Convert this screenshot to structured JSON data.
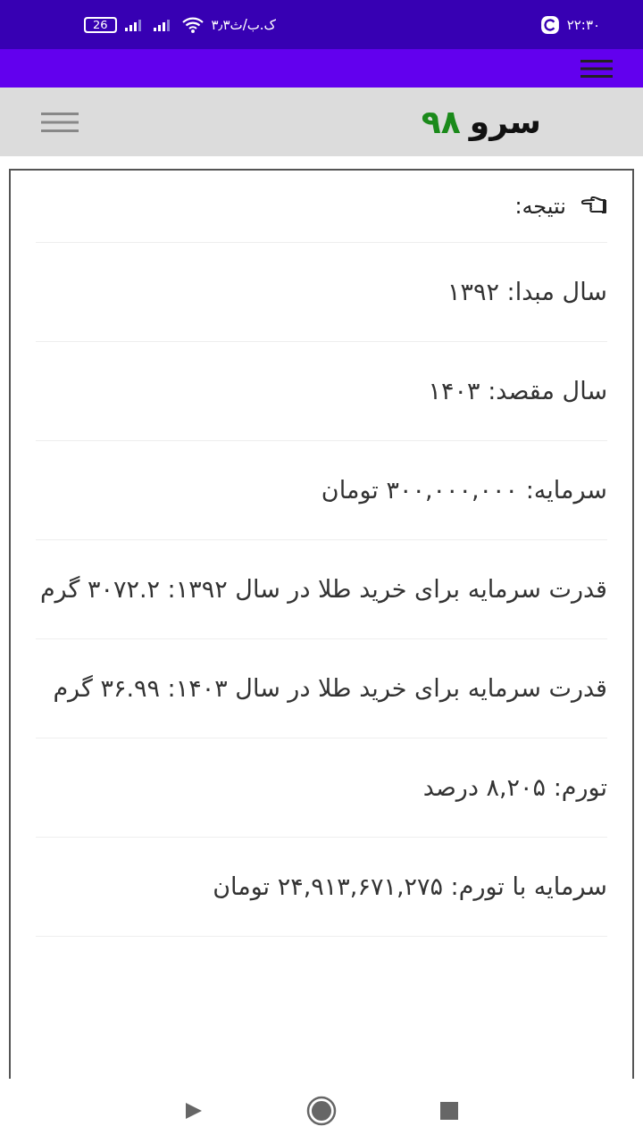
{
  "status_bar": {
    "time": "۲۲:۳۰",
    "speed": "۳٫۳ک.ب/ث",
    "battery": "26"
  },
  "header": {
    "logo_word": "سرو",
    "logo_number": "۹۸"
  },
  "result": {
    "title": "نتیجه:",
    "items": [
      {
        "text": "سال مبدا: ۱۳۹۲"
      },
      {
        "text": "سال مقصد: ۱۴۰۳"
      },
      {
        "text": "سرمایه: ۳۰۰,۰۰۰,۰۰۰ تومان"
      },
      {
        "text": "قدرت سرمایه برای خرید طلا در سال ۱۳۹۲: ۳۰۷۲.۲ گرم"
      },
      {
        "text": "قدرت سرمایه برای خرید طلا در سال ۱۴۰۳: ۳۶.۹۹ گرم"
      },
      {
        "text": "تورم: ۸,۲۰۵ درصد"
      },
      {
        "text": "سرمایه با تورم: ۲۴,۹۱۳,۶۷۱,۲۷۵ تومان"
      }
    ]
  }
}
